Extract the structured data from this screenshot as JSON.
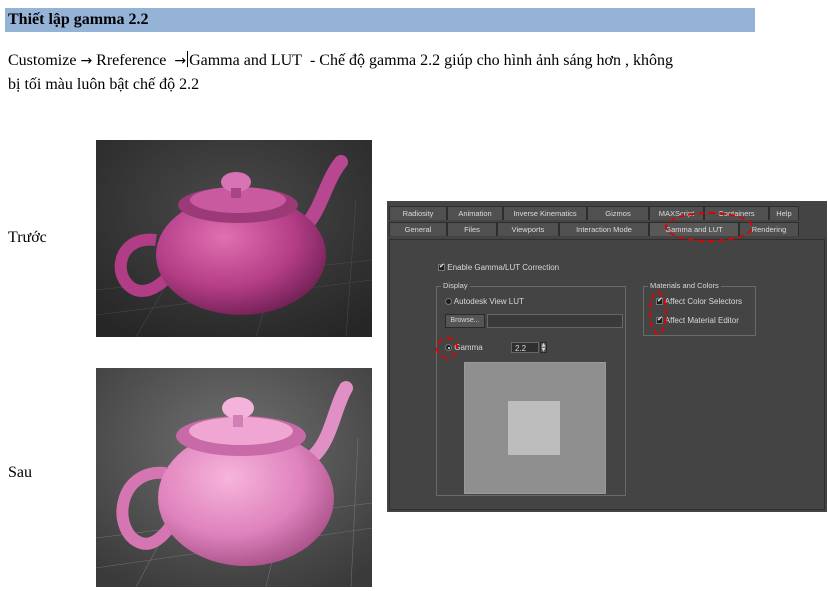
{
  "heading": "Thiết lập gamma 2.2",
  "path": {
    "step1": "Customize",
    "arrow": "→",
    "step2": "Rreference",
    "step3": "Gamma and LUT",
    "description": "- Chế độ gamma 2.2 giúp cho hình ảnh sáng hơn , không",
    "description_line2": "bị tối màu luôn bật chế độ 2.2"
  },
  "labels": {
    "before": "Trước",
    "after": "Sau"
  },
  "dialog": {
    "tabs_row1": [
      "Radiosity",
      "Animation",
      "Inverse Kinematics",
      "Gizmos",
      "MAXScript",
      "Containers",
      "Help"
    ],
    "tabs_row2": [
      "General",
      "Files",
      "Viewports",
      "Interaction Mode",
      "Gamma and LUT",
      "Rendering"
    ],
    "enable_label": "Enable Gamma/LUT Correction",
    "display_group": "Display",
    "autodesk_lut": "Autodesk View LUT",
    "browse_label": "Browse...",
    "gamma_label": "Gamma",
    "gamma_value": "2.2",
    "materials_group": "Materials and Colors",
    "affect_color": "Affect Color Selectors",
    "affect_material": "Affect Material Editor"
  },
  "colors": {
    "heading_bg": "#95b3d7",
    "highlight": "#e00000",
    "dialog_bg": "#444444"
  }
}
